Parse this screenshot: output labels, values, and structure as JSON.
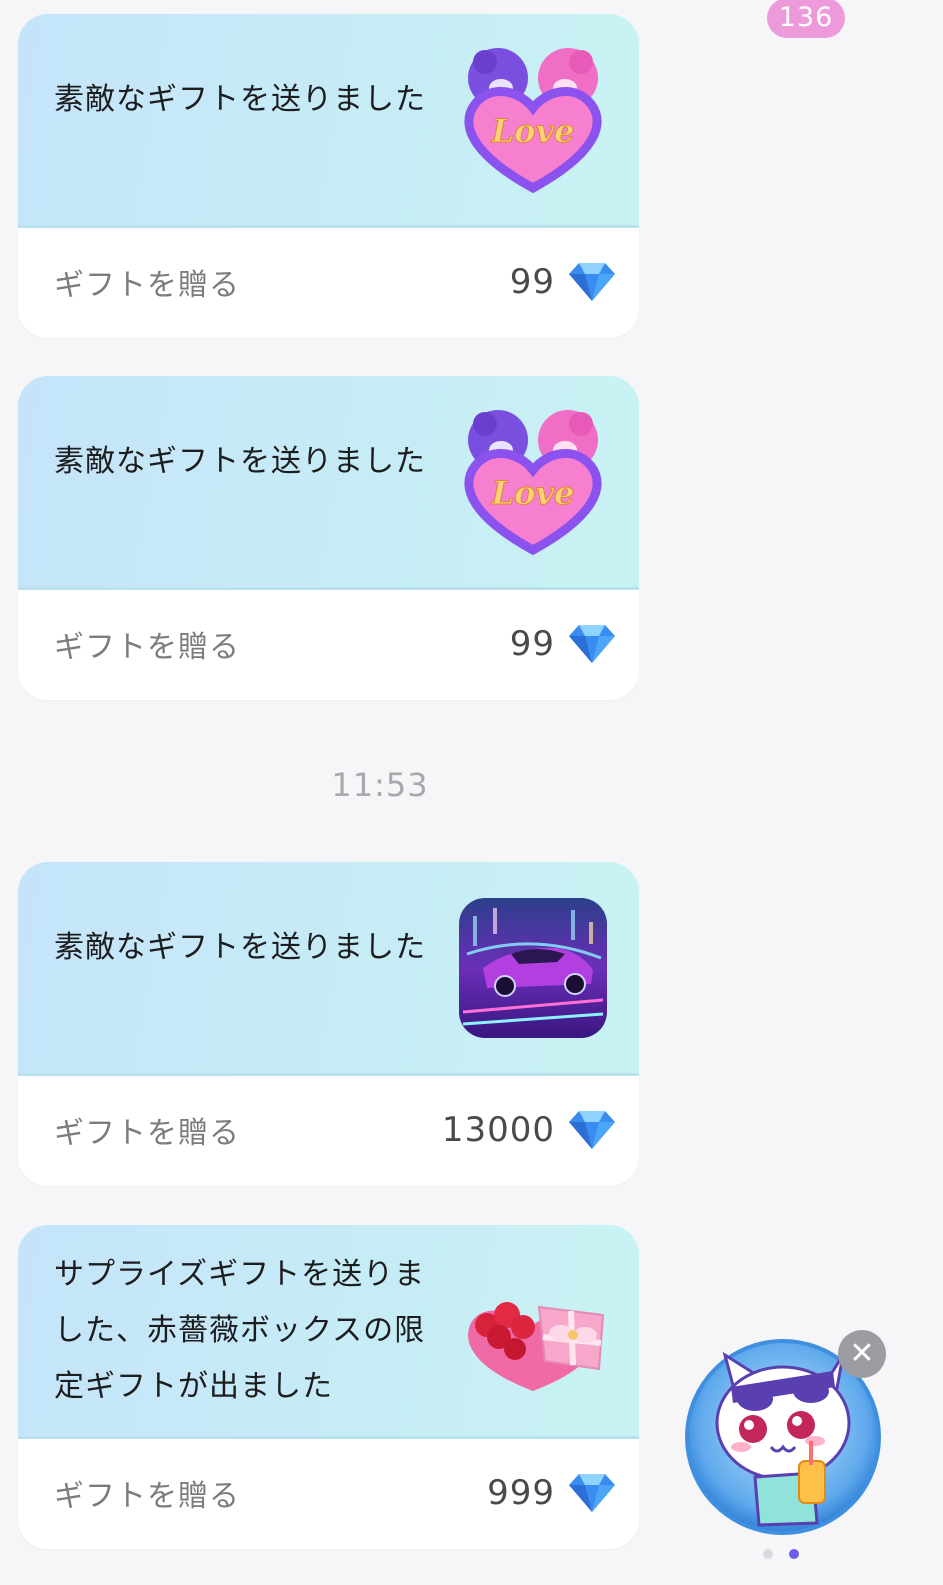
{
  "badge": {
    "count": "136"
  },
  "cards": [
    {
      "message": "素敵なギフトを送りました",
      "send_label": "ギフトを贈る",
      "price": "99",
      "gift_icon": "love-bears-heart-icon"
    },
    {
      "message": "素敵なギフトを送りました",
      "send_label": "ギフトを贈る",
      "price": "99",
      "gift_icon": "love-bears-heart-icon"
    },
    {
      "message": "素敵なギフトを送りました",
      "send_label": "ギフトを贈る",
      "price": "13000",
      "gift_icon": "sports-car-icon"
    },
    {
      "message": "サプライズギフトを送りました、赤薔薇ボックスの限定ギフトが出ました",
      "send_label": "ギフトを贈る",
      "price": "999",
      "gift_icon": "rose-heart-box-icon"
    }
  ],
  "timestamp": "11:53",
  "colors": {
    "card_top": "#c6ecf6",
    "badge": "#ec9ad9",
    "diamond": "#3a8df0",
    "active_dot": "#6d5ce7",
    "inactive_dot": "#d9d9de"
  },
  "floating_widget": {
    "icon": "cat-mascot-icon",
    "close_icon": "close-icon",
    "pages": 2,
    "active_page": 2
  }
}
